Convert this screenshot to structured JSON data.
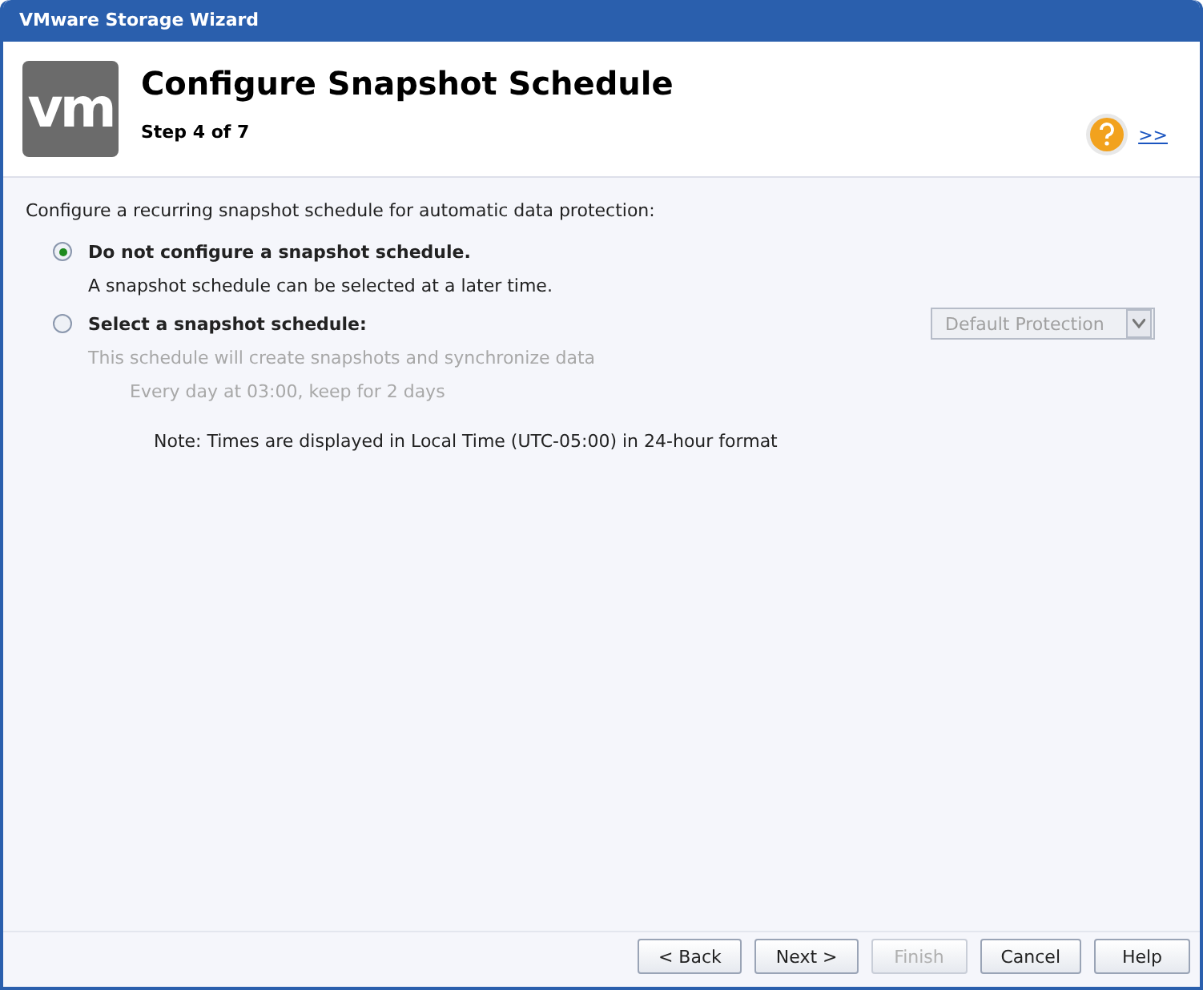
{
  "window": {
    "title": "VMware Storage Wizard"
  },
  "header": {
    "logo_text": "vm",
    "title": "Configure Snapshot Schedule",
    "step": "Step 4 of 7",
    "more_link": ">>"
  },
  "intro": "Configure a recurring snapshot schedule for automatic data protection:",
  "options": [
    {
      "label": "Do not configure a snapshot schedule.",
      "selected": true,
      "description": "A snapshot schedule can be selected at a later time."
    },
    {
      "label": "Select a snapshot schedule:",
      "selected": false,
      "description": "This schedule will create snapshots and synchronize data",
      "detail": "Every day at 03:00, keep for 2 days",
      "dropdown": {
        "value": "Default Protection",
        "disabled": true
      }
    }
  ],
  "note": "Note: Times are displayed in Local Time (UTC-05:00) in 24-hour format",
  "buttons": [
    {
      "label": "< Back",
      "disabled": false
    },
    {
      "label": "Next >",
      "disabled": false
    },
    {
      "label": "Finish",
      "disabled": true
    },
    {
      "label": "Cancel",
      "disabled": false
    },
    {
      "label": "Help",
      "disabled": false
    }
  ]
}
